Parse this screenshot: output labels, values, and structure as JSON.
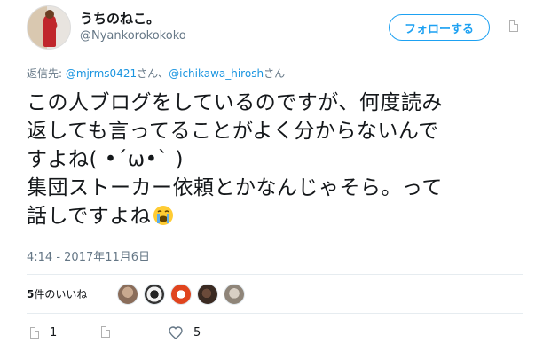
{
  "user": {
    "display_name": "うちのねこ。",
    "screen_name": "@Nyankorokokoko"
  },
  "follow_button": {
    "label": "フォローする"
  },
  "reply": {
    "prefix": "返信先: ",
    "mention1": "@mjrms0421",
    "suffix1": "さん、",
    "mention2": "@ichikawa_hirosh",
    "suffix2": "さん"
  },
  "tweet": {
    "lines": [
      "この人ブログをしているのですが、何度読み",
      "返しても言ってることがよく分からないんで",
      "すよね( •´ω•` )",
      "集団ストーカー依頼とかなんじゃそら。って",
      "話しですよね"
    ]
  },
  "timestamp": "4:14 - 2017年11月6日",
  "likes": {
    "count": "5",
    "label": "件のいいね"
  },
  "actions": {
    "reply_count": "1",
    "like_count": "5"
  },
  "colors": {
    "accent": "#1da1f2",
    "mention": "#1b95e0",
    "secondary_text": "#657786"
  }
}
